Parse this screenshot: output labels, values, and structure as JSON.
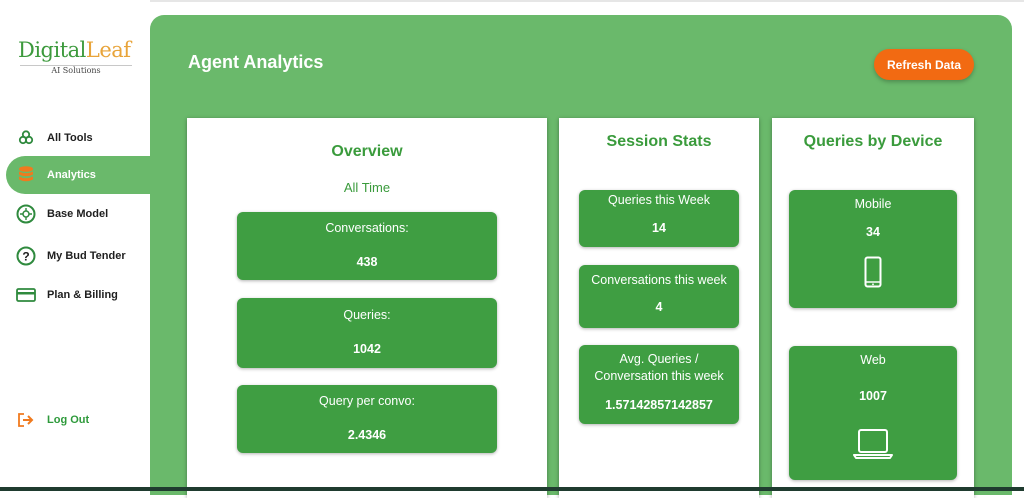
{
  "brand": {
    "name_part1": "Digital",
    "name_part2": "Leaf",
    "tagline": "AI Solutions"
  },
  "sidebar": {
    "items": [
      {
        "label": "All Tools",
        "icon": "tools-icon"
      },
      {
        "label": "Analytics",
        "icon": "database-icon",
        "active": true
      },
      {
        "label": "Base Model",
        "icon": "model-icon"
      },
      {
        "label": "My Bud Tender",
        "icon": "question-icon"
      },
      {
        "label": "Plan & Billing",
        "icon": "credit-card-icon"
      }
    ],
    "logout": {
      "label": "Log Out",
      "icon": "logout-icon"
    }
  },
  "header": {
    "title": "Agent Analytics",
    "refresh_label": "Refresh Data"
  },
  "overview": {
    "title": "Overview",
    "period": "All Time",
    "stats": [
      {
        "label": "Conversations:",
        "value": "438"
      },
      {
        "label": "Queries:",
        "value": "1042"
      },
      {
        "label": "Query per convo:",
        "value": "2.4346"
      }
    ]
  },
  "session": {
    "title": "Session Stats",
    "stats": [
      {
        "label": "Queries this Week",
        "value": "14"
      },
      {
        "label": "Conversations this week",
        "value": "4"
      },
      {
        "label": "Avg. Queries / Conversation this week",
        "value": "1.57142857142857"
      }
    ]
  },
  "devices": {
    "title": "Queries by Device",
    "items": [
      {
        "label": "Mobile",
        "value": "34",
        "icon": "mobile-icon"
      },
      {
        "label": "Web",
        "value": "1007",
        "icon": "laptop-icon"
      }
    ]
  },
  "colors": {
    "primary_green": "#6ab96b",
    "stat_green": "#3f9e42",
    "accent_orange": "#f26a12"
  }
}
